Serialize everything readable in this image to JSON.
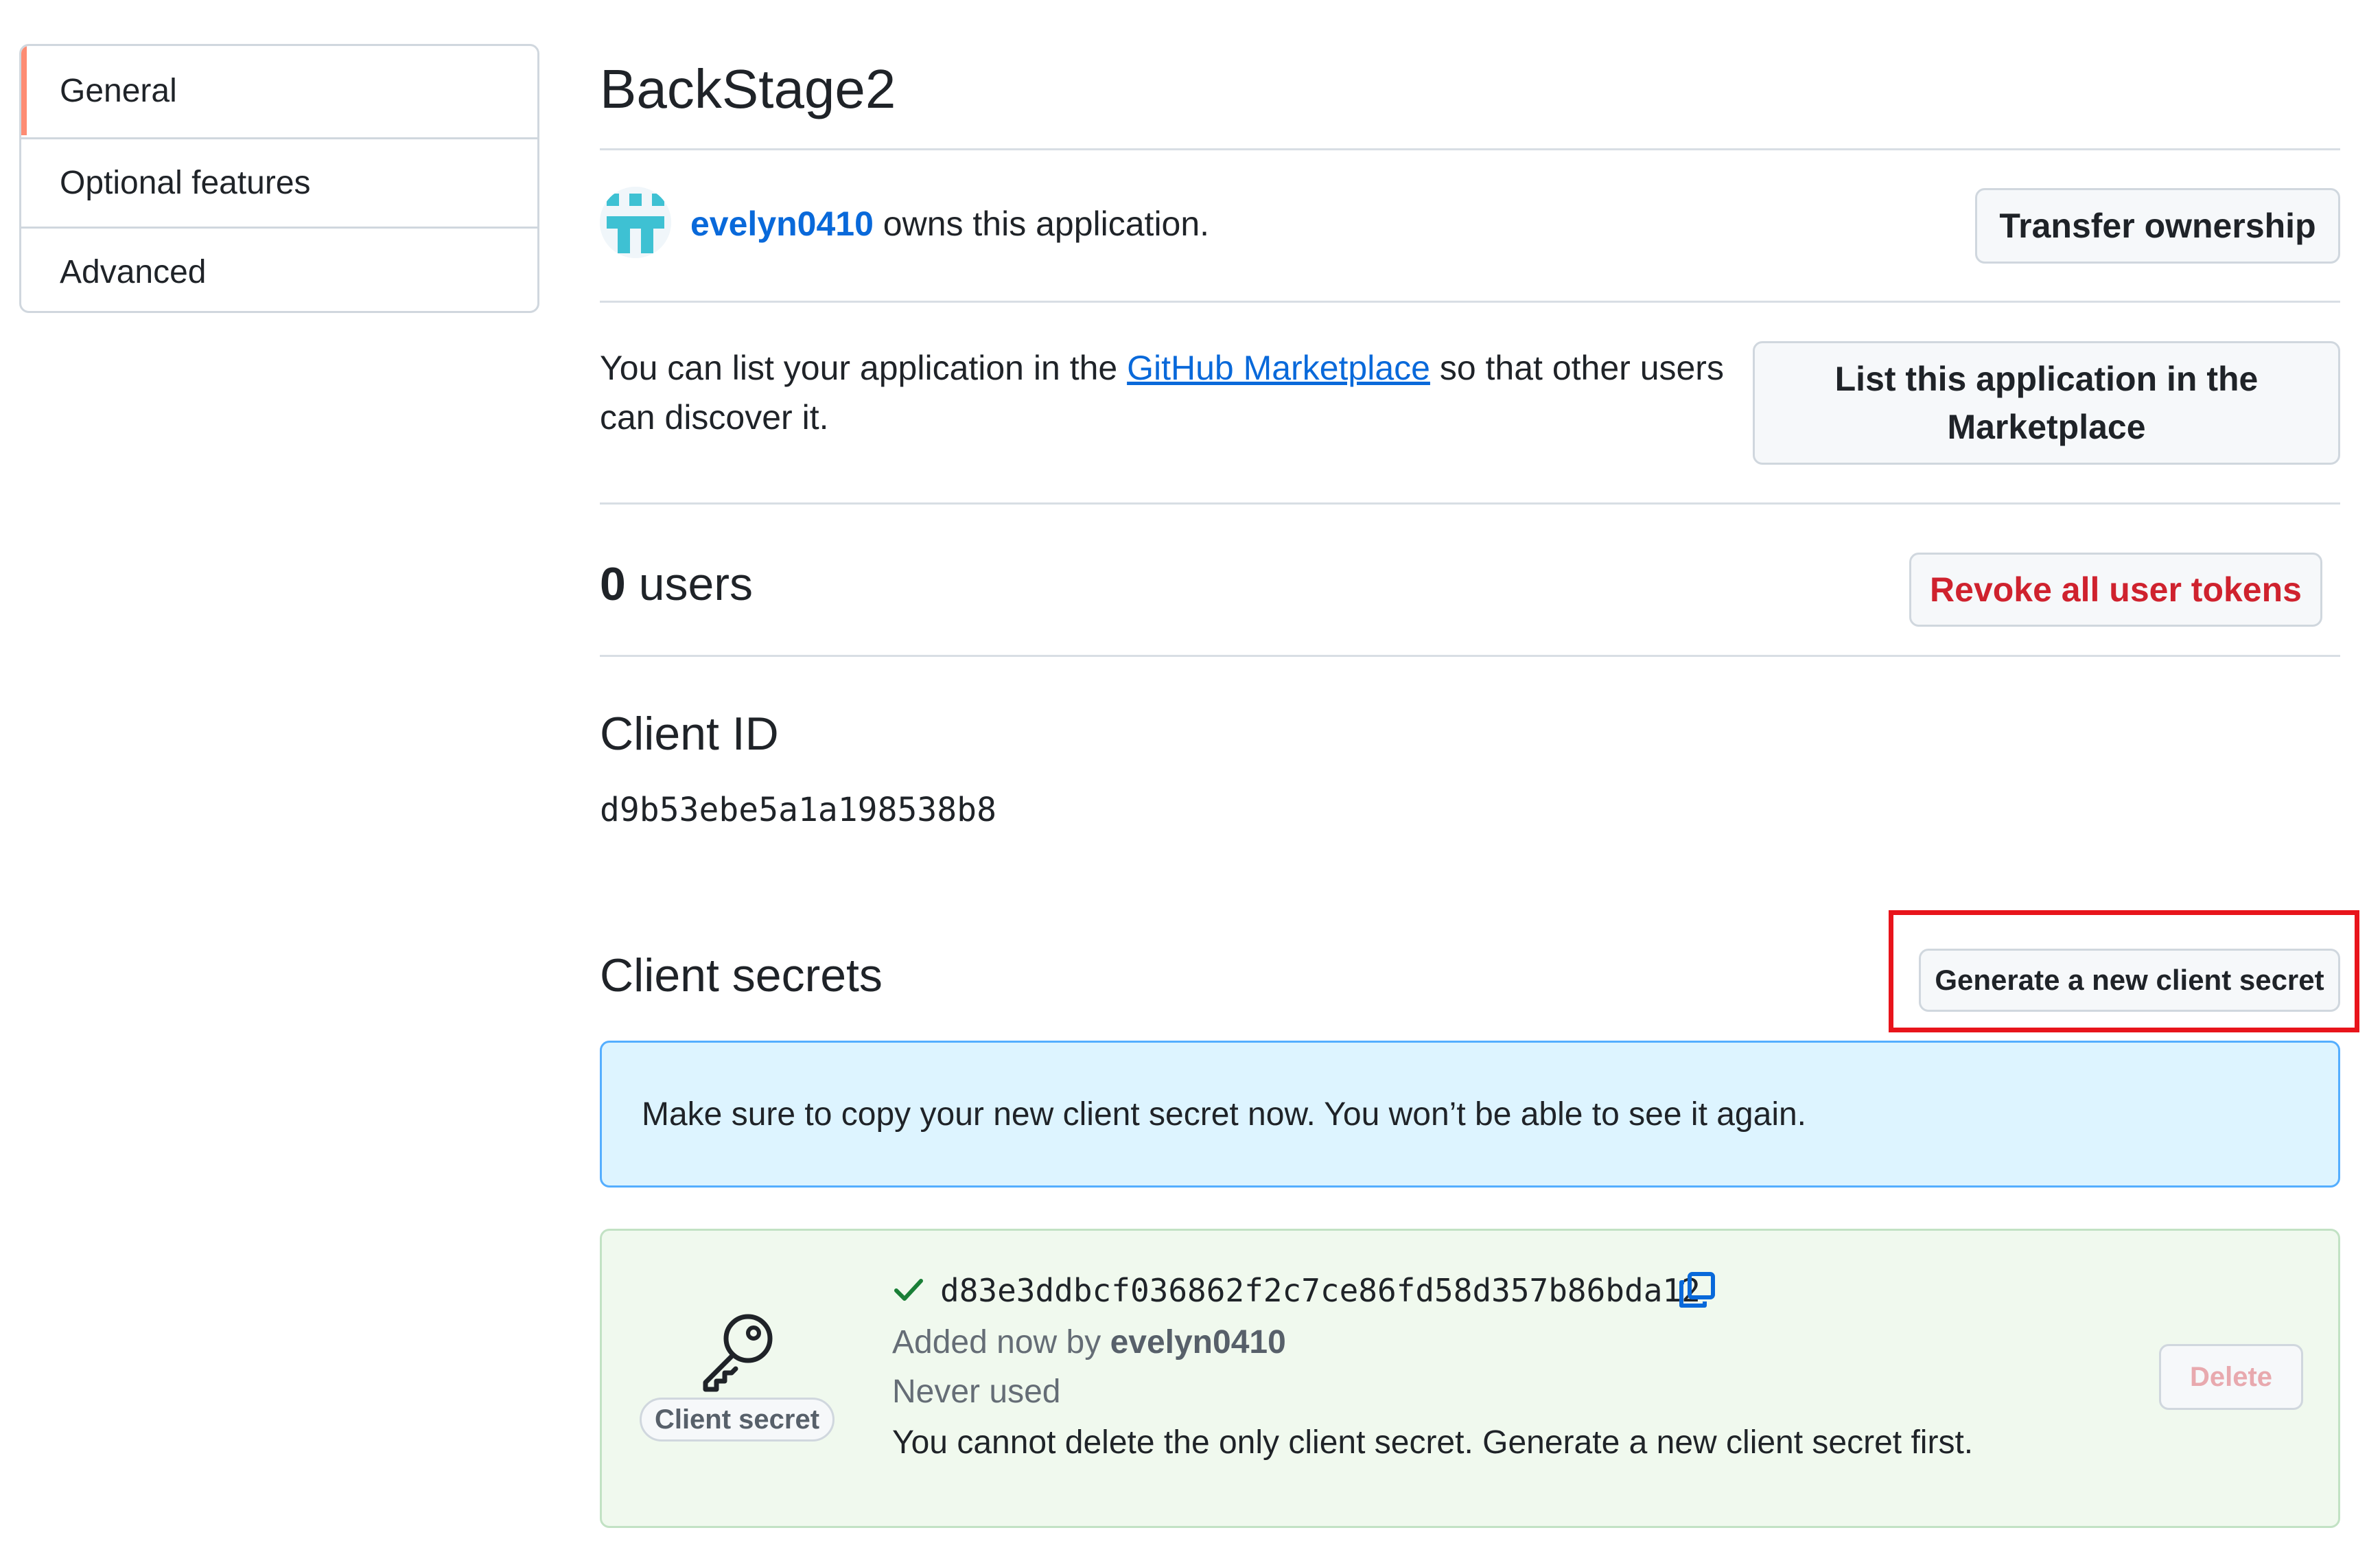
{
  "sidebar": {
    "items": [
      {
        "label": "General"
      },
      {
        "label": "Optional features"
      },
      {
        "label": "Advanced"
      }
    ]
  },
  "app": {
    "title": "BackStage2",
    "owner": "evelyn0410",
    "owns_text": " owns this application.",
    "transfer_label": "Transfer ownership"
  },
  "marketplace": {
    "text_before": "You can list your application in the ",
    "link": "GitHub Marketplace",
    "text_after": " so that other users can discover it.",
    "button_label": "List this application in the Marketplace"
  },
  "users": {
    "count": "0",
    "label": " users",
    "revoke_label": "Revoke all user tokens"
  },
  "client_id": {
    "heading": "Client ID",
    "value": "d9b53ebe5a1a198538b8"
  },
  "client_secrets": {
    "heading": "Client secrets",
    "generate_label": "Generate a new client secret",
    "flash_message": "Make sure to copy your new client secret now. You won’t be able to see it again.",
    "secret": {
      "badge": "Client secret",
      "value": "d83e3ddbcf036862f2c7ce86fd58d357b86bda12",
      "added_prefix": "Added now by ",
      "added_by": "evelyn0410",
      "usage": "Never used",
      "warning": "You cannot delete the only client secret. Generate a new client secret first.",
      "delete_label": "Delete"
    }
  },
  "colors": {
    "accent": "#0969da",
    "danger": "#cf222e",
    "highlight": "#e8141b",
    "flash_bg": "#ddf4ff",
    "success_bg": "#f0f9ee",
    "sidebar_selected": "#fd8c73"
  },
  "icons": [
    "identicon-avatar",
    "key-icon",
    "check-icon",
    "copy-icon"
  ]
}
